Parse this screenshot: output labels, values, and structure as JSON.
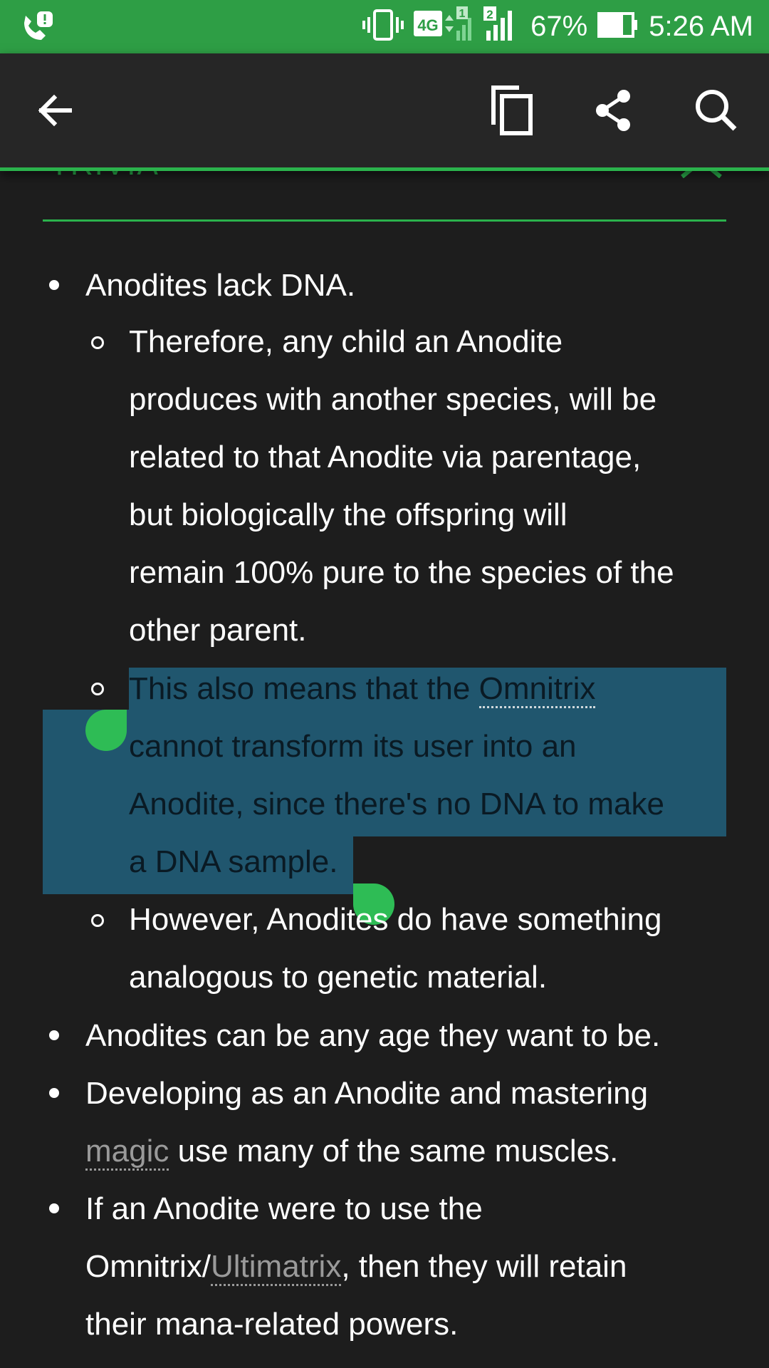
{
  "status_bar": {
    "battery_percent": "67%",
    "time": "5:26 AM",
    "network": "4G",
    "sim1": "1",
    "sim2": "2"
  },
  "toolbar": {
    "icons": [
      "back-arrow-icon",
      "copy-icon",
      "share-icon",
      "search-icon"
    ]
  },
  "section": {
    "title": "TRIVIA"
  },
  "trivia": {
    "item1": "Anodites lack DNA.",
    "sub1": [
      "Therefore, any child an Anodite",
      "produces with another species, will be",
      "related to that Anodite via parentage,",
      "but biologically the offspring will",
      "remain 100% pure to the species of the",
      "other parent."
    ],
    "sub2_pre": "This also means that the ",
    "sub2_link": "Omnitrix",
    "sub2_rest": [
      "cannot transform its user into an",
      "Anodite, since there's no DNA to make",
      "a DNA sample."
    ],
    "sub3": [
      "However, Anodites do have something",
      "analogous to genetic material."
    ],
    "item2": "Anodites can be any age they want to be.",
    "item3_line1": "Developing as an Anodite and mastering",
    "item3_link": "magic",
    "item3_rest": " use many of the same muscles.",
    "item4_line1": "If an Anodite were to use the",
    "item4_pre": "Omnitrix/",
    "item4_link": "Ultimatrix",
    "item4_rest": ", then they will retain",
    "item4_line3": "their mana-related powers."
  },
  "colors": {
    "accent": "#2bb24c",
    "status_bar": "#2e9e45",
    "toolbar": "#262626",
    "background": "#1d1d1d",
    "selection": "#20566e"
  }
}
